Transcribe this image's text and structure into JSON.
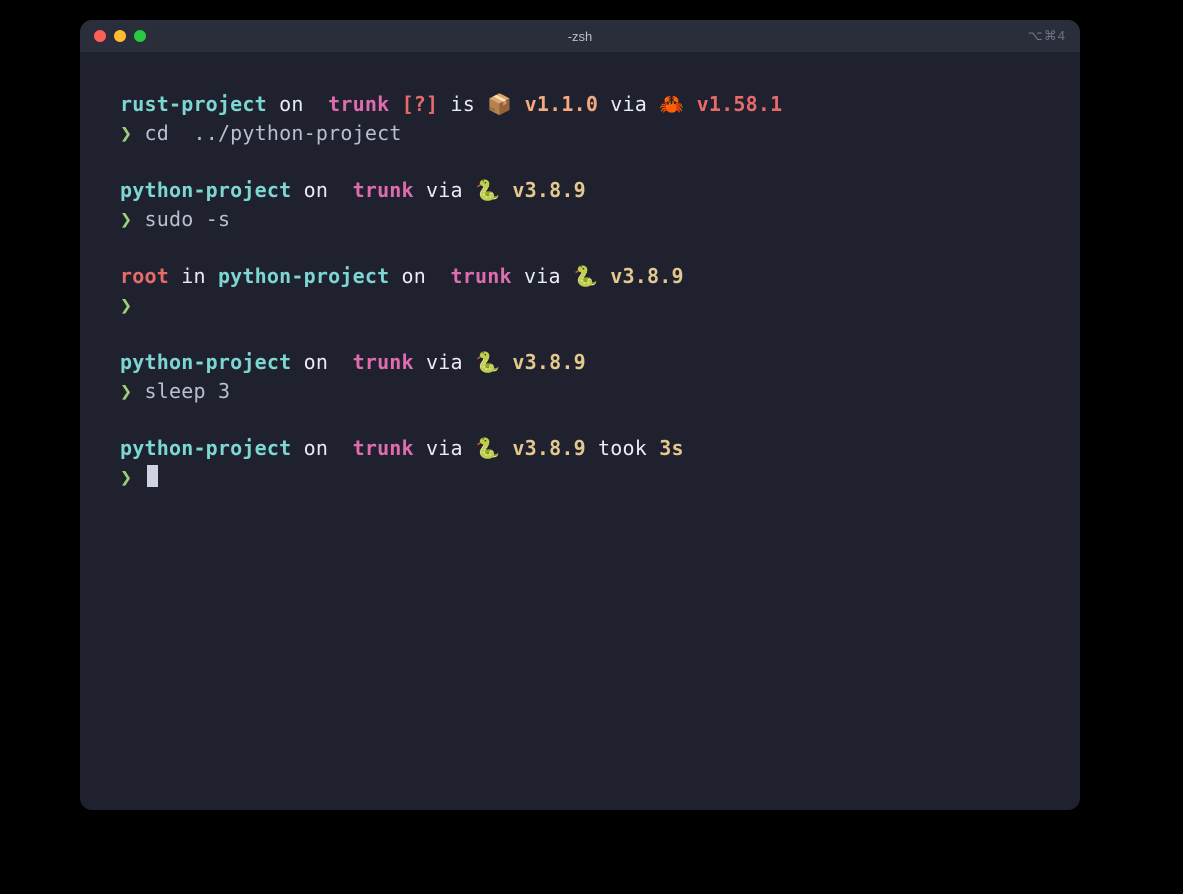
{
  "window": {
    "title": "-zsh",
    "shortcut_hint": "⌥⌘4"
  },
  "icons": {
    "git_branch": "",
    "package": "📦",
    "crab": "🦀",
    "python": "🐍",
    "prompt": "❯"
  },
  "blocks": [
    {
      "type": "prompt",
      "segments": [
        {
          "cls": "cyan bold",
          "bind": "s.rust_project"
        },
        {
          "cls": "white",
          "bind": "s.on"
        },
        {
          "cls": "magenta bold",
          "bind": "icons.git_branch"
        },
        {
          "cls": "magenta bold",
          "bind": "s.trunk"
        },
        {
          "cls": "red bold",
          "bind": "s.q"
        },
        {
          "cls": "white",
          "bind": "s.is"
        },
        {
          "cls": "orange",
          "bind": "icons.package"
        },
        {
          "cls": "orange bold",
          "bind": "s.v110"
        },
        {
          "cls": "white",
          "bind": "s.via"
        },
        {
          "cls": "red",
          "bind": "icons.crab"
        },
        {
          "cls": "red bold",
          "bind": "s.v1581"
        }
      ],
      "command": "cd  ../python-project"
    },
    {
      "type": "prompt",
      "segments": [
        {
          "cls": "cyan bold",
          "bind": "s.python_project"
        },
        {
          "cls": "white",
          "bind": "s.on"
        },
        {
          "cls": "magenta bold",
          "bind": "icons.git_branch"
        },
        {
          "cls": "magenta bold",
          "bind": "s.trunk"
        },
        {
          "cls": "white",
          "bind": "s.via"
        },
        {
          "cls": "yellow",
          "bind": "icons.python"
        },
        {
          "cls": "yellow bold",
          "bind": "s.v389"
        }
      ],
      "command": "sudo -s"
    },
    {
      "type": "prompt",
      "segments": [
        {
          "cls": "red bold",
          "bind": "s.root"
        },
        {
          "cls": "white",
          "bind": "s.in"
        },
        {
          "cls": "cyan bold",
          "bind": "s.python_project"
        },
        {
          "cls": "white",
          "bind": "s.on"
        },
        {
          "cls": "magenta bold",
          "bind": "icons.git_branch"
        },
        {
          "cls": "magenta bold",
          "bind": "s.trunk"
        },
        {
          "cls": "white",
          "bind": "s.via"
        },
        {
          "cls": "yellow",
          "bind": "icons.python"
        },
        {
          "cls": "yellow bold",
          "bind": "s.v389"
        }
      ],
      "command": ""
    },
    {
      "type": "prompt",
      "segments": [
        {
          "cls": "cyan bold",
          "bind": "s.python_project"
        },
        {
          "cls": "white",
          "bind": "s.on"
        },
        {
          "cls": "magenta bold",
          "bind": "icons.git_branch"
        },
        {
          "cls": "magenta bold",
          "bind": "s.trunk"
        },
        {
          "cls": "white",
          "bind": "s.via"
        },
        {
          "cls": "yellow",
          "bind": "icons.python"
        },
        {
          "cls": "yellow bold",
          "bind": "s.v389"
        }
      ],
      "command": "sleep 3"
    },
    {
      "type": "prompt",
      "segments": [
        {
          "cls": "cyan bold",
          "bind": "s.python_project"
        },
        {
          "cls": "white",
          "bind": "s.on"
        },
        {
          "cls": "magenta bold",
          "bind": "icons.git_branch"
        },
        {
          "cls": "magenta bold",
          "bind": "s.trunk"
        },
        {
          "cls": "white",
          "bind": "s.via"
        },
        {
          "cls": "yellow",
          "bind": "icons.python"
        },
        {
          "cls": "yellow bold",
          "bind": "s.v389"
        },
        {
          "cls": "white",
          "bind": "s.took"
        },
        {
          "cls": "yellow bold",
          "bind": "s.t3s"
        }
      ],
      "command": null,
      "cursor": true
    }
  ],
  "s": {
    "rust_project": "rust-project",
    "python_project": "python-project",
    "on": " on ",
    "in": " in ",
    "is": " is ",
    "via": " via ",
    "took": " took ",
    "trunk": " trunk",
    "q": " [?]",
    "v110": " v1.1.0",
    "v1581": " v1.58.1",
    "v389": " v3.8.9",
    "t3s": "3s",
    "root": "root"
  }
}
